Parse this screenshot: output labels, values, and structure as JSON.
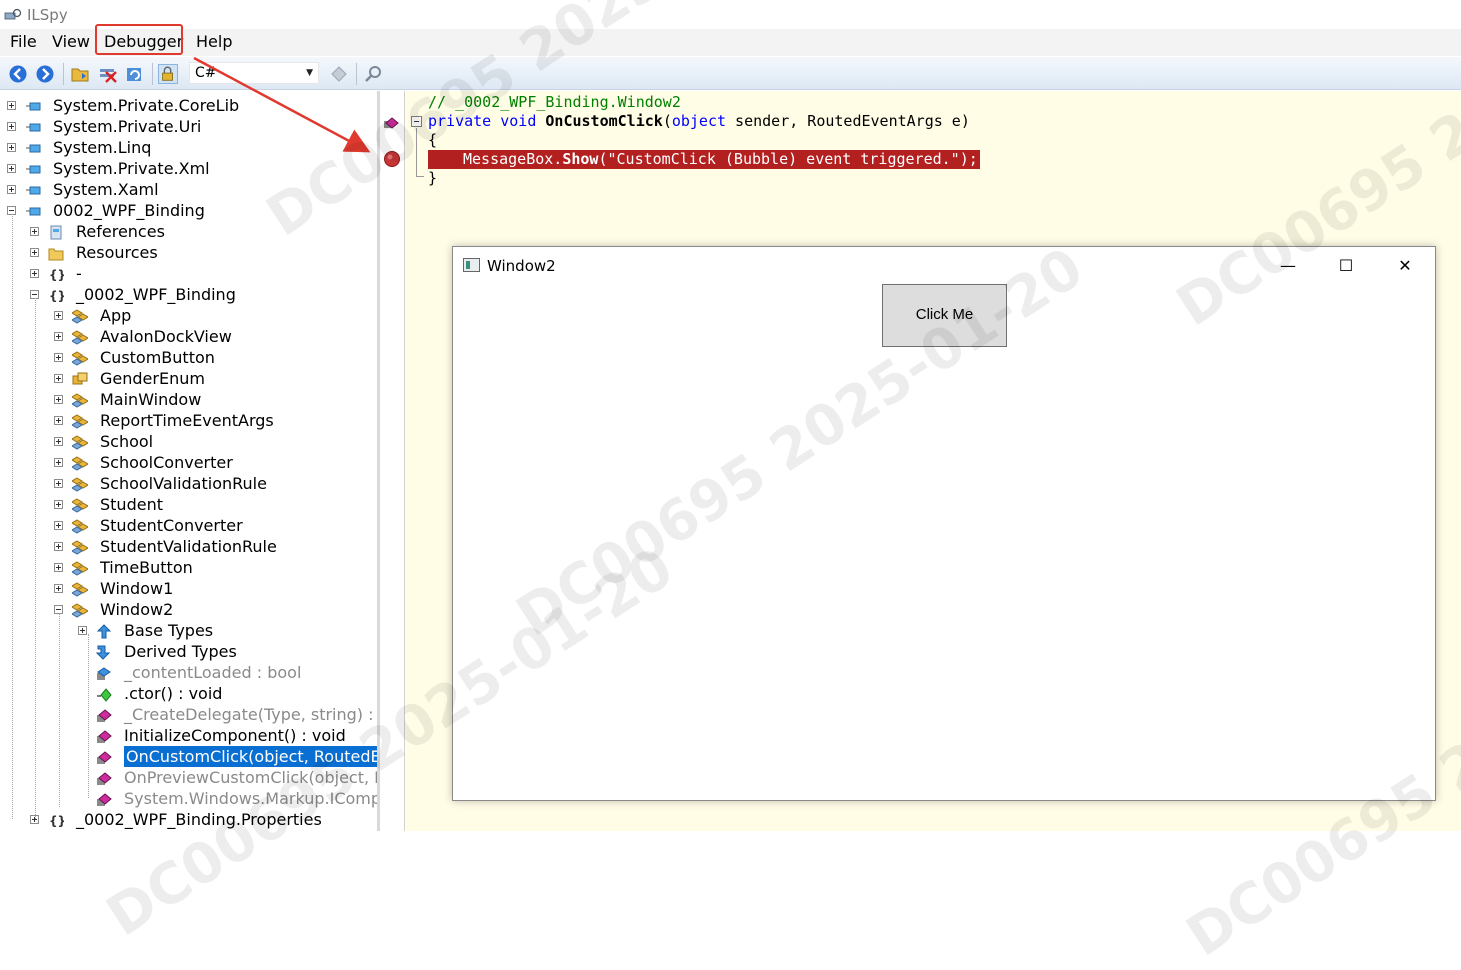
{
  "app": {
    "title": "ILSpy"
  },
  "menu": [
    "File",
    "View",
    "Debugger",
    "Help"
  ],
  "toolbar": {
    "language": "C#",
    "buttons": [
      "back-icon",
      "forward-icon",
      "open-icon",
      "unload-icon",
      "reload-icon",
      "show-private-icon",
      "navigate-icon",
      "search-icon"
    ]
  },
  "tree": [
    {
      "label": "System.Private.CoreLib",
      "icon": "assembly-icon",
      "level": 0,
      "expander": "plus"
    },
    {
      "label": "System.Private.Uri",
      "icon": "assembly-icon",
      "level": 0,
      "expander": "plus"
    },
    {
      "label": "System.Linq",
      "icon": "assembly-icon",
      "level": 0,
      "expander": "plus"
    },
    {
      "label": "System.Private.Xml",
      "icon": "assembly-icon",
      "level": 0,
      "expander": "plus"
    },
    {
      "label": "System.Xaml",
      "icon": "assembly-icon",
      "level": 0,
      "expander": "plus"
    },
    {
      "label": "0002_WPF_Binding",
      "icon": "assembly-icon",
      "level": 0,
      "expander": "minus"
    },
    {
      "label": "References",
      "icon": "references-icon",
      "level": 1,
      "expander": "plus"
    },
    {
      "label": "Resources",
      "icon": "folder-icon",
      "level": 1,
      "expander": "plus"
    },
    {
      "label": "-",
      "icon": "namespace-icon",
      "level": 1,
      "expander": "plus"
    },
    {
      "label": "_0002_WPF_Binding",
      "icon": "namespace-icon",
      "level": 1,
      "expander": "minus"
    },
    {
      "label": "App",
      "icon": "class-icon",
      "level": 2,
      "expander": "plus"
    },
    {
      "label": "AvalonDockView",
      "icon": "class-icon",
      "level": 2,
      "expander": "plus"
    },
    {
      "label": "CustomButton",
      "icon": "class-icon",
      "level": 2,
      "expander": "plus"
    },
    {
      "label": "GenderEnum",
      "icon": "enum-icon",
      "level": 2,
      "expander": "plus"
    },
    {
      "label": "MainWindow",
      "icon": "class-icon",
      "level": 2,
      "expander": "plus"
    },
    {
      "label": "ReportTimeEventArgs",
      "icon": "class-icon",
      "level": 2,
      "expander": "plus"
    },
    {
      "label": "School",
      "icon": "class-icon",
      "level": 2,
      "expander": "plus"
    },
    {
      "label": "SchoolConverter",
      "icon": "class-icon",
      "level": 2,
      "expander": "plus"
    },
    {
      "label": "SchoolValidationRule",
      "icon": "class-icon",
      "level": 2,
      "expander": "plus"
    },
    {
      "label": "Student",
      "icon": "class-icon",
      "level": 2,
      "expander": "plus"
    },
    {
      "label": "StudentConverter",
      "icon": "class-icon",
      "level": 2,
      "expander": "plus"
    },
    {
      "label": "StudentValidationRule",
      "icon": "class-icon",
      "level": 2,
      "expander": "plus"
    },
    {
      "label": "TimeButton",
      "icon": "class-icon",
      "level": 2,
      "expander": "plus"
    },
    {
      "label": "Window1",
      "icon": "class-icon",
      "level": 2,
      "expander": "plus"
    },
    {
      "label": "Window2",
      "icon": "class-icon",
      "level": 2,
      "expander": "minus"
    },
    {
      "label": "Base Types",
      "icon": "base-types-icon",
      "level": 3,
      "expander": "plus"
    },
    {
      "label": "Derived Types",
      "icon": "derived-types-icon",
      "level": 3,
      "expander": "none"
    },
    {
      "label": "_contentLoaded : bool",
      "icon": "field-icon",
      "level": 3,
      "expander": "none",
      "dim": true
    },
    {
      "label": ".ctor() : void",
      "icon": "constructor-icon",
      "level": 3,
      "expander": "none"
    },
    {
      "label": "_CreateDelegate(Type, string) : De",
      "icon": "method-icon",
      "level": 3,
      "expander": "none",
      "dim": true
    },
    {
      "label": "InitializeComponent() : void",
      "icon": "method-icon",
      "level": 3,
      "expander": "none"
    },
    {
      "label": "OnCustomClick(object, RoutedEve",
      "icon": "method-icon",
      "level": 3,
      "expander": "none",
      "selected": true
    },
    {
      "label": "OnPreviewCustomClick(object, Rou",
      "icon": "method-icon",
      "level": 3,
      "expander": "none",
      "dim": true
    },
    {
      "label": "System.Windows.Markup.ICompor",
      "icon": "method-icon",
      "level": 3,
      "expander": "none",
      "dim": true
    },
    {
      "label": "_0002_WPF_Binding.Properties",
      "icon": "namespace-icon",
      "level": 1,
      "expander": "plus"
    }
  ],
  "code": {
    "comment": "// _0002_WPF_Binding.Window2",
    "signature_kw1": "private",
    "signature_kw2": "void",
    "signature_name": "OnCustomClick",
    "signature_kw3": "object",
    "signature_rest": " sender, RoutedEventArgs e)",
    "open_brace": "{",
    "bp_text_a": "MessageBox.",
    "bp_text_b": "Show",
    "bp_text_c": "(\"CustomClick (Bubble) event triggered.\");",
    "close_brace": "}"
  },
  "window2": {
    "title": "Window2",
    "minimize": "—",
    "maximize": "☐",
    "close": "✕",
    "button_label": "Click Me"
  },
  "watermark": "DC00695 2025-01-20",
  "colors": {
    "accent_red": "#e03a2f",
    "selection": "#0a6fd2",
    "breakpoint": "#b22020",
    "code_bg": "#fffde6"
  }
}
